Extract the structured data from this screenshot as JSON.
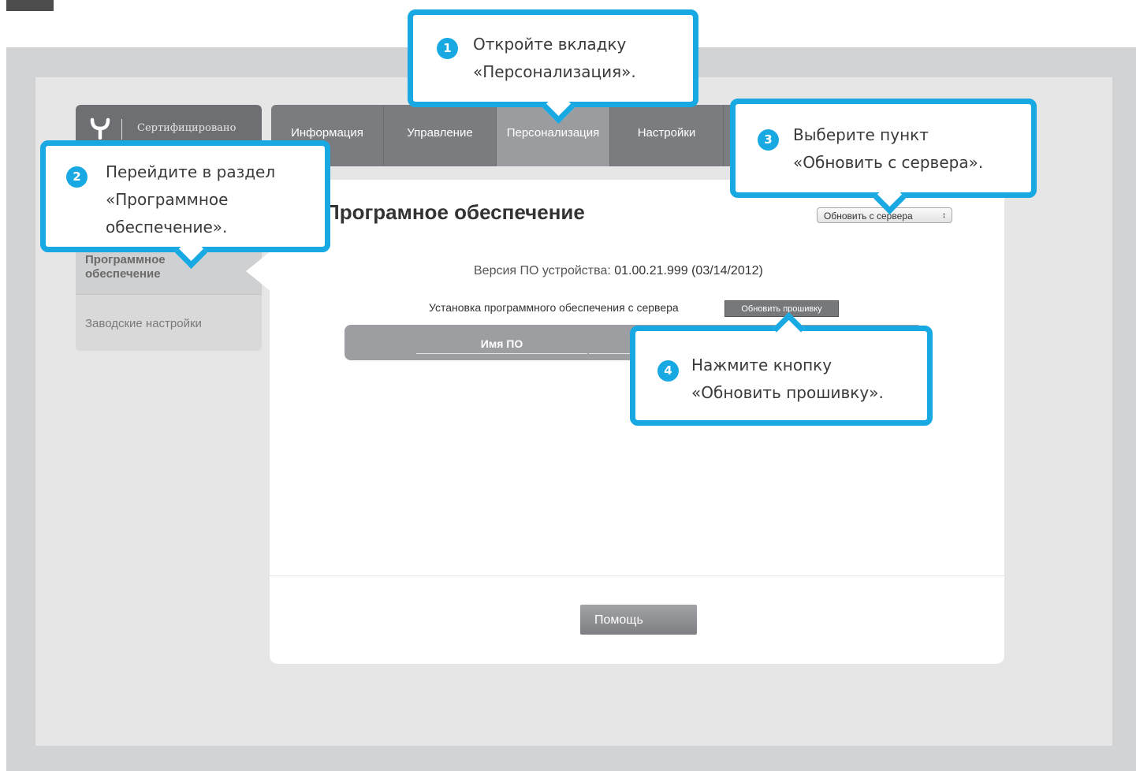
{
  "app": {
    "logo_text": "Сертифицировано"
  },
  "tabs": [
    {
      "label": "Информация"
    },
    {
      "label": "Управление"
    },
    {
      "label": "Персонализация",
      "active": true
    },
    {
      "label": "Настройки"
    }
  ],
  "sidebar": {
    "items": [
      {
        "label": "Программное обеспечение",
        "active": true
      },
      {
        "label": "Заводские настройки"
      }
    ]
  },
  "main": {
    "title": "Програмное обеспечение",
    "server_select": "Обновить с сервера",
    "fw_version_label": "Версия ПО устройства:",
    "fw_version_value": "01.00.21.999 (03/14/2012)",
    "install_label": "Установка программного обеспечения с сервера",
    "update_button": "Обновить прошивку",
    "table_headers": [
      "Имя ПО"
    ],
    "help_button": "Помощь"
  },
  "callouts": [
    {
      "num": "1",
      "text": "Откройте вкладку\n«Персонализация»."
    },
    {
      "num": "2",
      "text": "Перейдите в раздел\n«Программное\nобеспечение»."
    },
    {
      "num": "3",
      "text": "Выберите пункт\n«Обновить с сервера»."
    },
    {
      "num": "4",
      "text": "Нажмите кнопку\n«Обновить прошивку»."
    }
  ],
  "colors": {
    "accent": "#18a9e3",
    "tab_bar": "#7b7c7f",
    "tab_active": "#9b9c9f",
    "frame": "#d2d3d5"
  }
}
